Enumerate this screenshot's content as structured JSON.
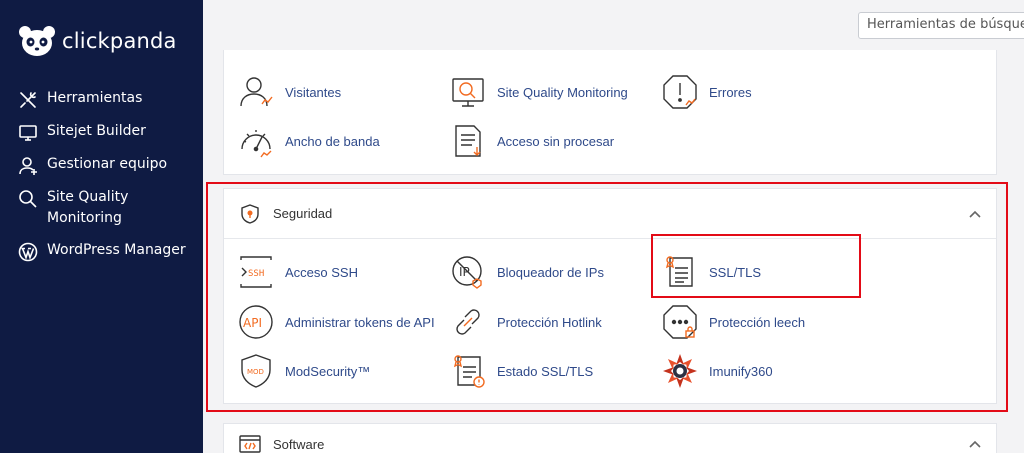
{
  "brand": {
    "name": "clickpanda"
  },
  "sidebar": {
    "items": [
      {
        "label": "Herramientas",
        "icon": "tools-icon"
      },
      {
        "label": "Sitejet Builder",
        "icon": "monitor-icon"
      },
      {
        "label": "Gestionar equipo",
        "icon": "user-add-icon"
      },
      {
        "label": "Site Quality Monitoring",
        "icon": "search-icon"
      },
      {
        "label": "WordPress Manager",
        "icon": "wordpress-icon"
      }
    ]
  },
  "search": {
    "placeholder": "Herramientas de búsqueda"
  },
  "metrics": {
    "items": [
      {
        "label": "Visitantes",
        "icon": "visitors-icon"
      },
      {
        "label": "Site Quality Monitoring",
        "icon": "site-quality-icon"
      },
      {
        "label": "Errores",
        "icon": "errors-icon"
      },
      {
        "label": "Ancho de banda",
        "icon": "bandwidth-icon"
      },
      {
        "label": "Acceso sin procesar",
        "icon": "raw-access-icon"
      }
    ]
  },
  "security": {
    "title": "Seguridad",
    "items": [
      {
        "label": "Acceso SSH",
        "icon": "ssh-icon"
      },
      {
        "label": "Bloqueador de IPs",
        "icon": "ip-blocker-icon"
      },
      {
        "label": "SSL/TLS",
        "icon": "ssl-tls-icon"
      },
      {
        "label": "Administrar tokens de API",
        "icon": "api-icon"
      },
      {
        "label": "Protección Hotlink",
        "icon": "hotlink-icon"
      },
      {
        "label": "Protección leech",
        "icon": "leech-icon"
      },
      {
        "label": "ModSecurity™",
        "icon": "modsecurity-icon"
      },
      {
        "label": "Estado SSL/TLS",
        "icon": "ssl-status-icon"
      },
      {
        "label": "Imunify360",
        "icon": "imunify-icon"
      }
    ]
  },
  "software": {
    "title": "Software",
    "icon": "code-icon"
  },
  "colors": {
    "sidebar": "#0f1b43",
    "accent": "#f26b21",
    "link": "#2f4a8a",
    "highlight": "#e30b17"
  }
}
